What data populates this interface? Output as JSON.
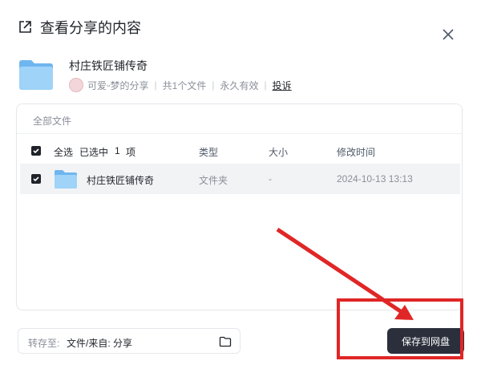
{
  "dialog": {
    "title": "查看分享的内容"
  },
  "share": {
    "name": "村庄铁匠铺传奇",
    "owner": "可爱ᵕ梦的分享",
    "count": "共1个文件",
    "validity": "永久有效",
    "report": "投诉"
  },
  "files": {
    "breadcrumb": "全部文件",
    "header": {
      "select_all": "全选",
      "selected": "已选中",
      "selected_count": "1",
      "selected_unit": "项",
      "type": "类型",
      "size": "大小",
      "modified": "修改时间"
    },
    "rows": [
      {
        "name": "村庄铁匠铺传奇",
        "type": "文件夹",
        "size": "-",
        "modified": "2024-10-13 13:13",
        "checked": true
      }
    ]
  },
  "footer": {
    "saveto_label": "转存至:",
    "saveto_value": "文件/来自: 分享",
    "save_button": "保存到网盘"
  },
  "colors": {
    "annotation": "#e02626",
    "button": "#2b2f3b",
    "folder": "#8ec9f5"
  },
  "icons": [
    "share-external-icon",
    "close-icon",
    "folder-icon",
    "checkbox-checked-icon",
    "folder-outline-icon"
  ]
}
